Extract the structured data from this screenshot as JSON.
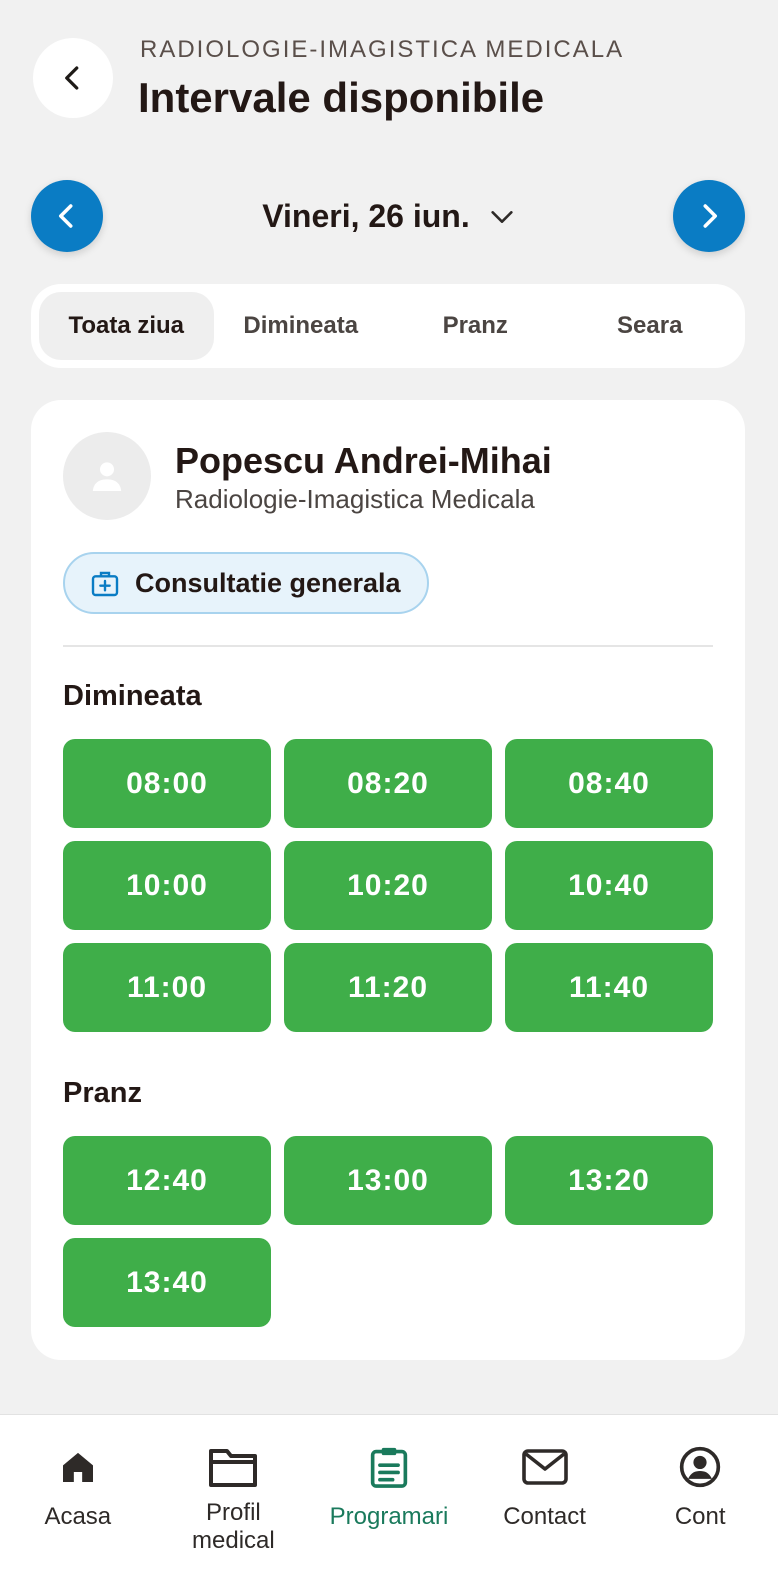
{
  "header": {
    "kicker": "RADIOLOGIE-IMAGISTICA MEDICALA",
    "title": "Intervale disponibile"
  },
  "date_nav": {
    "label": "Vineri, 26 iun.",
    "accent": "#0a7cc4"
  },
  "filter_tabs": [
    {
      "label": "Toata ziua",
      "active": true
    },
    {
      "label": "Dimineata",
      "active": false
    },
    {
      "label": "Pranz",
      "active": false
    },
    {
      "label": "Seara",
      "active": false
    }
  ],
  "doctor": {
    "name": "Popescu Andrei-Mihai",
    "specialty": "Radiologie-Imagistica Medicala",
    "avatar_icon": "user-icon"
  },
  "service": {
    "label": "Consultatie generala",
    "icon": "medical-kit-icon"
  },
  "sections": [
    {
      "title": "Dimineata",
      "slots": [
        "08:00",
        "08:20",
        "08:40",
        "10:00",
        "10:20",
        "10:40",
        "11:00",
        "11:20",
        "11:40"
      ]
    },
    {
      "title": "Pranz",
      "slots": [
        "12:40",
        "13:00",
        "13:20",
        "13:40"
      ]
    }
  ],
  "slot_color": "#3fae49",
  "tabbar": {
    "items": [
      {
        "label": "Acasa",
        "icon": "home-icon"
      },
      {
        "label": "Profil\nmedical",
        "icon": "folder-icon"
      },
      {
        "label": "Programari",
        "icon": "clipboard-icon",
        "active": true
      },
      {
        "label": "Contact",
        "icon": "mail-icon"
      },
      {
        "label": "Cont",
        "icon": "account-icon"
      }
    ],
    "active_color": "#1a7a5c"
  }
}
